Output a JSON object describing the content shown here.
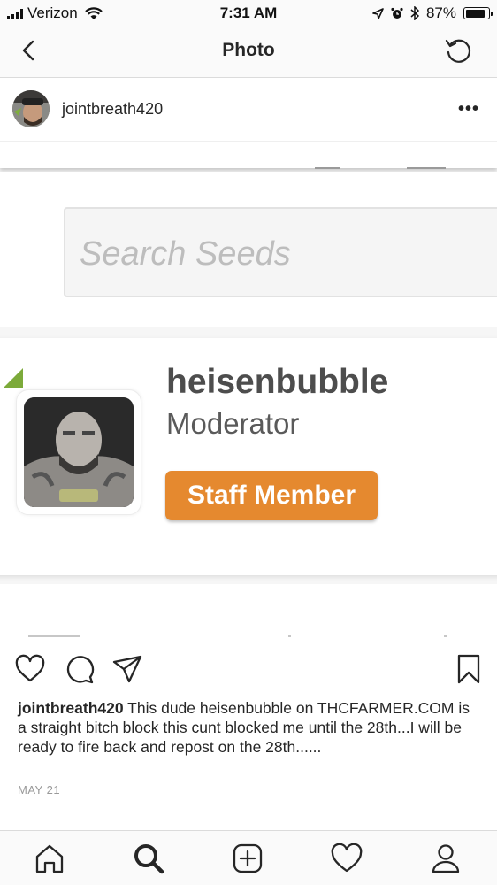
{
  "status_bar": {
    "carrier": "Verizon",
    "time": "7:31 AM",
    "battery": "87%",
    "battery_level": 0.87
  },
  "header": {
    "title": "Photo",
    "back_icon": "chevron-left-icon",
    "refresh_icon": "refresh-icon"
  },
  "post": {
    "username": "jointbreath420",
    "more_icon": "more-dots-icon"
  },
  "photo": {
    "search_placeholder": "Search Seeds",
    "profile_name": "heisenbubble",
    "profile_role": "Moderator",
    "badge_label": "Staff Member",
    "badge_color": "#e5892f"
  },
  "actions": [
    "heart-icon",
    "comment-icon",
    "share-icon",
    "bookmark-icon"
  ],
  "caption": {
    "username": "jointbreath420",
    "text": "This dude heisenbubble on THCFARMER.COM is a straight bitch block this cunt blocked me until the 28th...I will be ready to fire back and repost on the 28th......"
  },
  "date": "MAY 21",
  "tabbar": [
    "home-icon",
    "search-icon",
    "add-icon",
    "activity-heart-icon",
    "profile-icon"
  ]
}
